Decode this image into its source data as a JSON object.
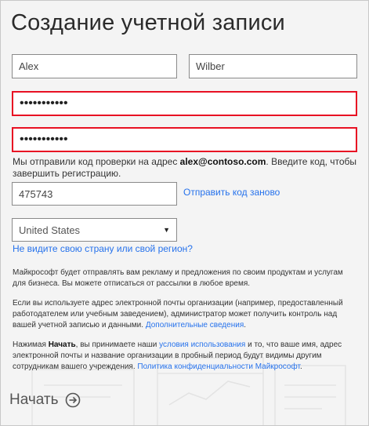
{
  "title": "Создание учетной записи",
  "form": {
    "first_name": "Alex",
    "last_name": "Wilber",
    "password": "•••••••••••",
    "password_confirm": "•••••••••••",
    "code_note_prefix": "Мы отправили код проверки на адрес ",
    "code_note_email": "alex@contoso.com",
    "code_note_suffix": ". Введите код, чтобы завершить регистрацию.",
    "code": "475743",
    "resend_link": "Отправить код заново",
    "country": "United States",
    "country_link": "Не видите свою страну или свой регион?"
  },
  "legal": {
    "marketing": "Майкрософт будет отправлять вам рекламу и предложения по своим продуктам и услугам для бизнеса. Вы можете отписаться от рассылки в любое время.",
    "org_email_text": "Если вы используете адрес электронной почты организации (например, предоставленный работодателем или учебным заведением), администратор может получить контроль над вашей учетной записью и данными. ",
    "org_email_link": "Дополнительные сведения",
    "terms_prefix": "Нажимая ",
    "terms_bold": "Начать",
    "terms_mid1": ", вы принимаете наши ",
    "terms_link": "условия использования",
    "terms_mid2": " и то, что ваше имя, адрес электронной почты и название организации в пробный период будут видимы другим сотрудникам вашего учреждения. ",
    "privacy_link": "Политика конфиденциальности Майкрософт",
    "period": "."
  },
  "actions": {
    "start_label": "Начать"
  },
  "colors": {
    "accent": "#2672ec",
    "error_border": "#e81123"
  }
}
